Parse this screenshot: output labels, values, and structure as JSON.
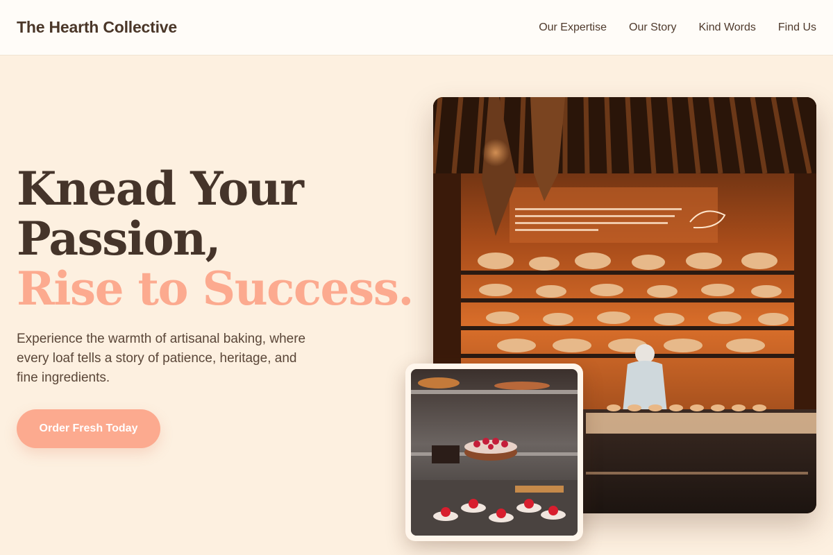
{
  "header": {
    "brand": "The Hearth Collective",
    "nav": [
      "Our Expertise",
      "Our Story",
      "Kind Words",
      "Find Us"
    ]
  },
  "hero": {
    "title_line1": "Knead Your",
    "title_line2": "Passion,",
    "title_accent": "Rise to Success.",
    "description": "Experience the warmth of artisanal baking, where every loaf tells a story of patience, heritage, and fine ingredients.",
    "cta_label": "Order Fresh Today"
  },
  "colors": {
    "background": "#fdf0e0",
    "header_bg": "#fffcf8",
    "text_dark": "#45342a",
    "accent": "#fcaa8f"
  }
}
